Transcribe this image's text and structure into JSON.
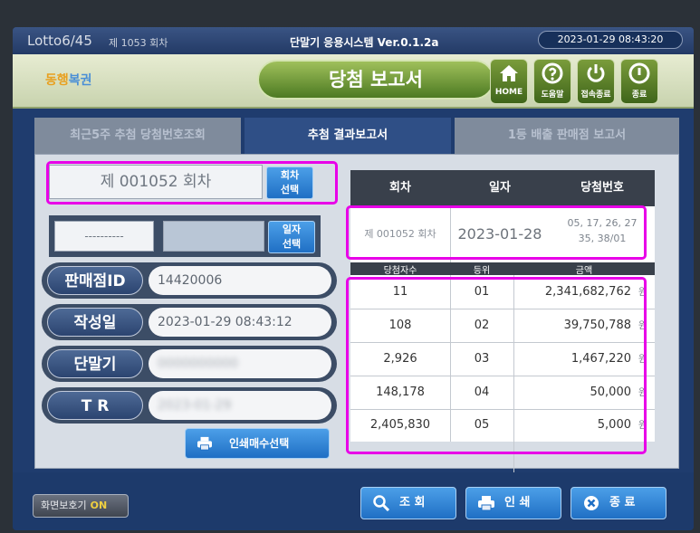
{
  "titlebar": {
    "brand": "Lotto6/45",
    "round": "제 1053 회차",
    "system": "단말기 응용시스템 Ver.0.1.2a",
    "datetime": "2023-01-29 08:43:20"
  },
  "header": {
    "logo_part1": "동행",
    "logo_part2": "복권",
    "title": "당첨 보고서",
    "buttons": [
      {
        "label": "HOME",
        "icon": "home-icon"
      },
      {
        "label": "도움말",
        "icon": "help-icon"
      },
      {
        "label": "접속종료",
        "icon": "power-icon"
      },
      {
        "label": "종료",
        "icon": "exit-icon"
      }
    ]
  },
  "tabs": [
    {
      "label": "최근5주 추첨 당첨번호조회",
      "active": false
    },
    {
      "label": "추첨 결과보고서",
      "active": true
    },
    {
      "label": "1등 배출 판매점 보고서",
      "active": false
    }
  ],
  "left": {
    "round_value": "제 001052 회차",
    "round_select": [
      "회차",
      "선택"
    ],
    "date_from": "----------",
    "date_to": "",
    "date_select": [
      "일자",
      "선택"
    ],
    "rows": [
      {
        "label": "판매점ID",
        "value": "14420006",
        "blurred": false
      },
      {
        "label": "작성일",
        "value": "2023-01-29  08:43:12",
        "blurred": false
      },
      {
        "label": "단말기",
        "value": "0000000000",
        "blurred": true
      },
      {
        "label": "T R",
        "value": "2023-01-29",
        "blurred": true
      }
    ],
    "print_count_label": "인쇄매수선택"
  },
  "table": {
    "headers": [
      "회차",
      "일자",
      "당첨번호"
    ],
    "draw": {
      "round": "제 001052 회차",
      "date": "2023-01-28",
      "numbers_line1": "05, 17, 26, 27",
      "numbers_line2": "35, 38/01"
    },
    "sub_headers": [
      "당첨자수",
      "등위",
      "금액"
    ],
    "currency": "원",
    "rows": [
      {
        "winners": "11",
        "rank": "01",
        "amount": "2,341,682,762"
      },
      {
        "winners": "108",
        "rank": "02",
        "amount": "39,750,788"
      },
      {
        "winners": "2,926",
        "rank": "03",
        "amount": "1,467,220"
      },
      {
        "winners": "148,178",
        "rank": "04",
        "amount": "50,000"
      },
      {
        "winners": "2,405,830",
        "rank": "05",
        "amount": "5,000"
      }
    ]
  },
  "footer": {
    "saver_label": "화면보호기",
    "saver_state": "ON",
    "inquiry": "조 회",
    "print": "인 쇄",
    "exit": "종 료"
  },
  "colors": {
    "highlight": "#e800e8",
    "accent_green": "#4d7a22",
    "button_blue": "#1f6fc4"
  }
}
